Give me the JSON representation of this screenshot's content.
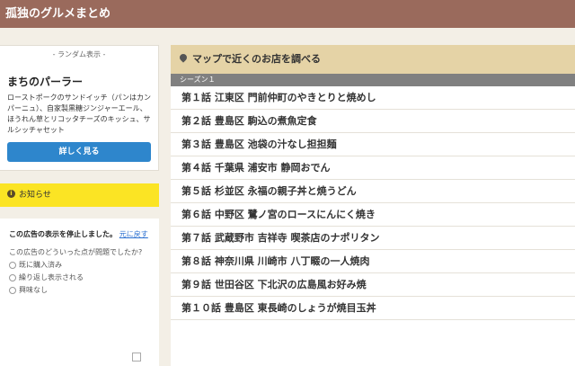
{
  "header": {
    "title": "孤独のグルメまとめ"
  },
  "random": {
    "caption": "- ランダム表示 -",
    "shop_name": "まちのパーラー",
    "description": "ローストポークのサンドイッチ（パンはカンパーニュ）、自家製黒糖ジンジャーエール、ほうれん草とリコッタチーズのキッシュ、サルシッチャセット",
    "detail_label": "詳しく見る"
  },
  "notice": {
    "icon": "info-icon",
    "label": "お知らせ"
  },
  "ad": {
    "stopped_text": "この広告の表示を停止しました。",
    "undo_label": "元に戻す",
    "question": "この広告のどういった点が問題でしたか?",
    "options": [
      "既に購入済み",
      "繰り返し表示される",
      "興味なし"
    ]
  },
  "map": {
    "icon": "map-pin-icon",
    "title": "マップで近くのお店を調べる"
  },
  "season": {
    "label": "シーズン１"
  },
  "episodes": [
    "第１話 江東区 門前仲町のやきとりと焼めし",
    "第２話 豊島区 駒込の煮魚定食",
    "第３話 豊島区 池袋の汁なし担担麺",
    "第４話 千葉県 浦安市 静岡おでん",
    "第５話 杉並区 永福の親子丼と焼うどん",
    "第６話 中野区 鷺ノ宮のロースにんにく焼き",
    "第７話 武蔵野市 吉祥寺 喫茶店のナポリタン",
    "第８話 神奈川県 川崎市 八丁畷の一人焼肉",
    "第９話 世田谷区 下北沢の広島風お好み焼",
    "第１０話 豊島区 東長崎のしょうが焼目玉丼"
  ]
}
